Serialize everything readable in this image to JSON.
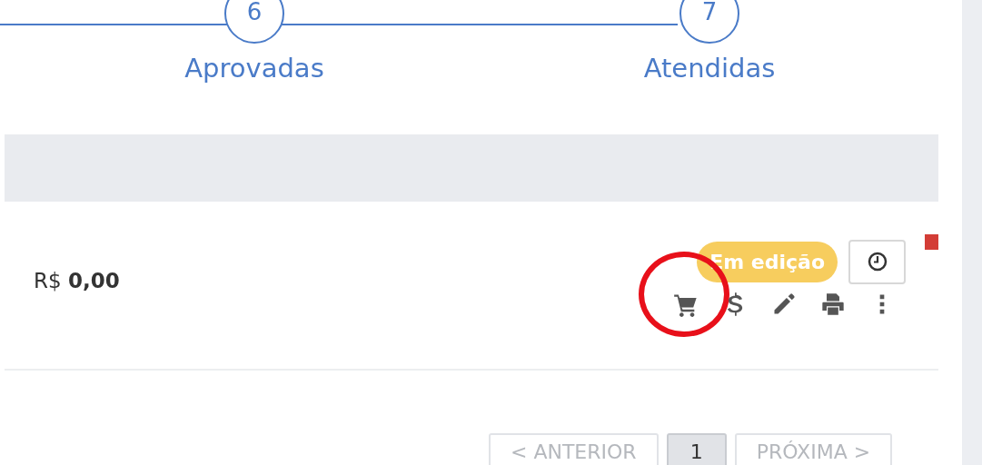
{
  "steps": [
    {
      "number": "6",
      "label": "Aprovadas"
    },
    {
      "number": "7",
      "label": "Atendidas"
    }
  ],
  "row": {
    "currency": "R$",
    "amount": "0,00",
    "status": "Em edição",
    "flagged": true,
    "actions": [
      {
        "kind": "cart",
        "highlighted": true
      },
      {
        "kind": "dollar",
        "highlighted": false
      },
      {
        "kind": "pencil",
        "highlighted": false
      },
      {
        "kind": "printer",
        "highlighted": false
      },
      {
        "kind": "more",
        "highlighted": false
      }
    ]
  },
  "pagination": {
    "previous": "< ANTERIOR",
    "pages": [
      {
        "label": "1",
        "selected": true
      }
    ],
    "next": "PRÓXIMA >"
  }
}
